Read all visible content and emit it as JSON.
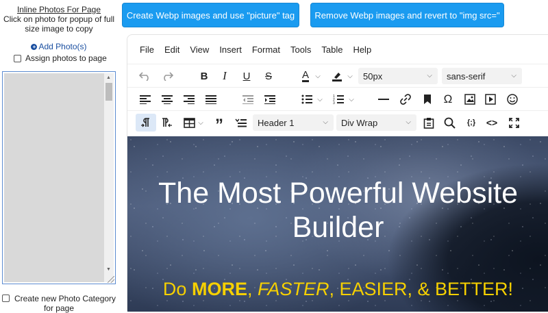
{
  "left_panel": {
    "title": "Inline Photos For Page",
    "subtitle": "Click on photo for popup of full size image to copy",
    "add_photo_label": "Add Photo(s)",
    "assign_label": "Assign photos to page",
    "new_category_label": "Create new Photo Category for page"
  },
  "buttons": {
    "create_webp": "Create Webp images and use \"picture\" tag",
    "remove_webp": "Remove Webp images and revert to \"img src=\""
  },
  "menubar": [
    "File",
    "Edit",
    "View",
    "Insert",
    "Format",
    "Tools",
    "Table",
    "Help"
  ],
  "toolbar": {
    "font_size": "50px",
    "font_family": "sans-serif",
    "block_format": "Header 1",
    "div_wrap": "Div Wrap"
  },
  "content": {
    "title": "The Most Powerful Website Builder",
    "sub_do": "Do ",
    "sub_more": "MORE",
    "sub_comma1": ", ",
    "sub_faster": "FASTER",
    "sub_rest": ", EASIER, & BETTER!"
  },
  "colors": {
    "button_bg": "#1a9bf0",
    "accent_yellow": "#f6d000",
    "link_blue": "#1a4fa0"
  }
}
